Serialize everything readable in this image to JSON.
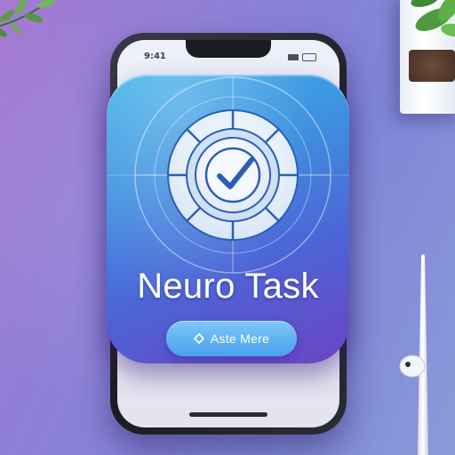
{
  "phone": {
    "status_time": "9:41"
  },
  "app": {
    "title": "Neuro Task",
    "cta_label": "Aste Mere",
    "cta_icon": "diamond-icon",
    "emblem_icon": "checkmark-target-icon"
  },
  "colors": {
    "card_top": "#3fb3e9",
    "card_bottom": "#6c44c4",
    "button": "#4b9ff0",
    "background": "#8d7fd7"
  }
}
